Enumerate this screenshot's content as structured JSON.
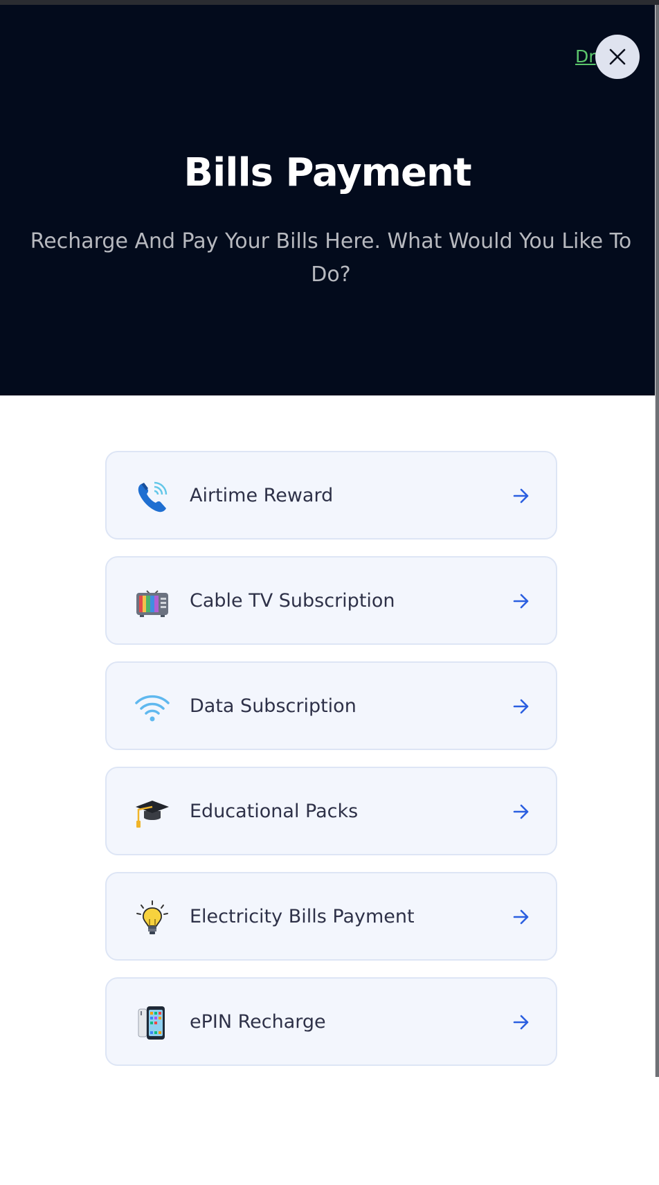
{
  "header": {
    "drawer_link": "Dr",
    "title": "Bills Payment",
    "subtitle": "Recharge And Pay Your Bills Here. What Would You Like To Do?"
  },
  "services": [
    {
      "label": "Airtime Reward",
      "icon": "phone-icon"
    },
    {
      "label": "Cable TV Subscription",
      "icon": "tv-icon"
    },
    {
      "label": "Data Subscription",
      "icon": "wifi-icon"
    },
    {
      "label": "Educational Packs",
      "icon": "graduation-cap-icon"
    },
    {
      "label": "Electricity Bills Payment",
      "icon": "light-bulb-icon"
    },
    {
      "label": "ePIN Recharge",
      "icon": "mobile-phone-icon"
    }
  ],
  "colors": {
    "hero_bg": "#030b1c",
    "card_bg": "#f3f6fd",
    "arrow": "#2a5ee0",
    "link": "#5cc66c"
  }
}
